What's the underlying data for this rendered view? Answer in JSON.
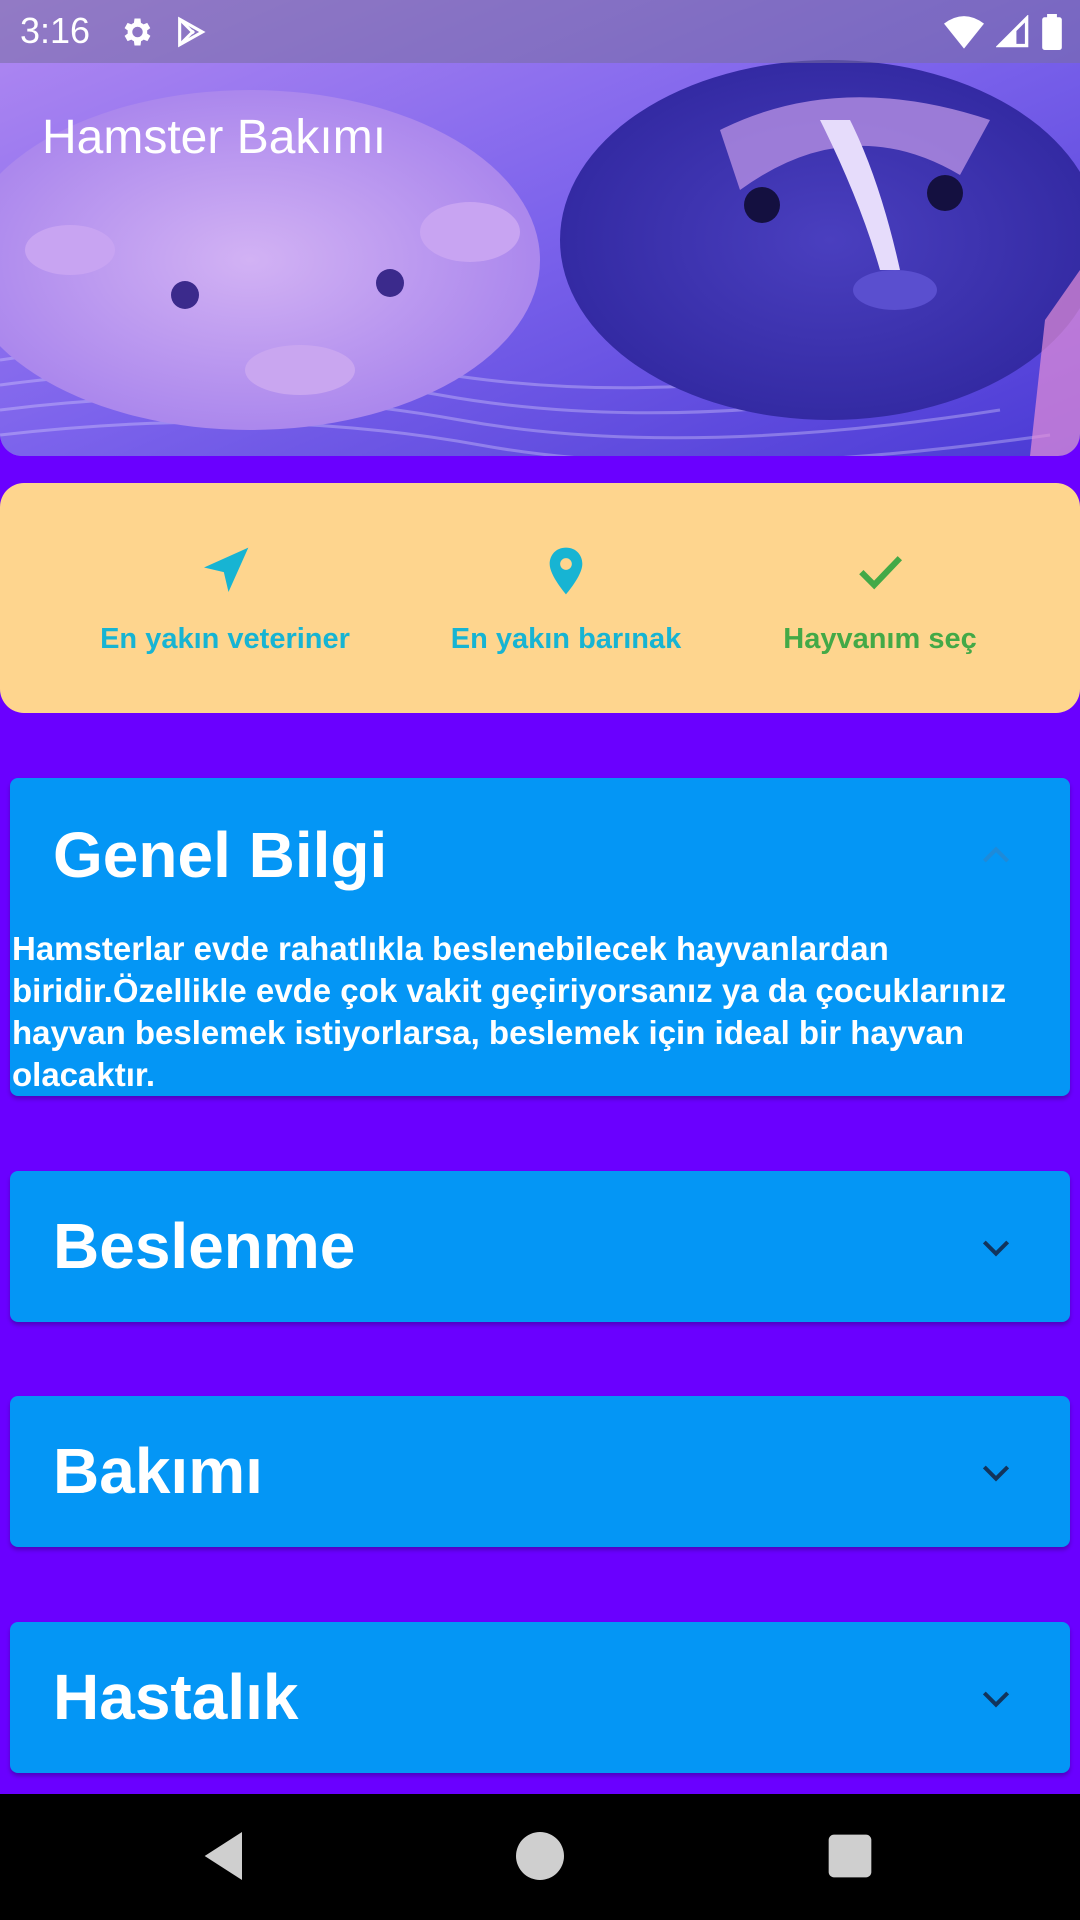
{
  "status_bar": {
    "time": "3:16",
    "left_icons": [
      "gear-icon",
      "play-store-icon"
    ],
    "right_icons": [
      "wifi-icon",
      "signal-icon",
      "battery-icon"
    ]
  },
  "header": {
    "title": "Hamster Bakımı",
    "image": "guinea-pigs-photo"
  },
  "actions": [
    {
      "label": "En yakın veteriner",
      "icon": "navigation-arrow-icon",
      "color": "#17b4d3"
    },
    {
      "label": "En yakın barınak",
      "icon": "location-pin-icon",
      "color": "#17b4d3"
    },
    {
      "label": "Hayvanım seç",
      "icon": "check-icon",
      "color": "#43a947"
    }
  ],
  "sections": [
    {
      "title": "Genel Bilgi",
      "expanded": true,
      "body": "Hamsterlar evde rahatlıkla beslenebilecek hayvanlardan biridir.Özellikle evde çok vakit geçiriyorsanız ya da çocuklarınız hayvan beslemek istiyorlarsa, beslemek için ideal bir hayvan olacaktır."
    },
    {
      "title": "Beslenme",
      "expanded": false
    },
    {
      "title": "Bakımı",
      "expanded": false
    },
    {
      "title": "Hastalık",
      "expanded": false
    }
  ],
  "colors": {
    "background": "#6a00ff",
    "action_card": "#fed58e",
    "panel": "#0496f5"
  },
  "nav_bar": {
    "icons": [
      "back-icon",
      "home-icon",
      "recents-icon"
    ]
  }
}
